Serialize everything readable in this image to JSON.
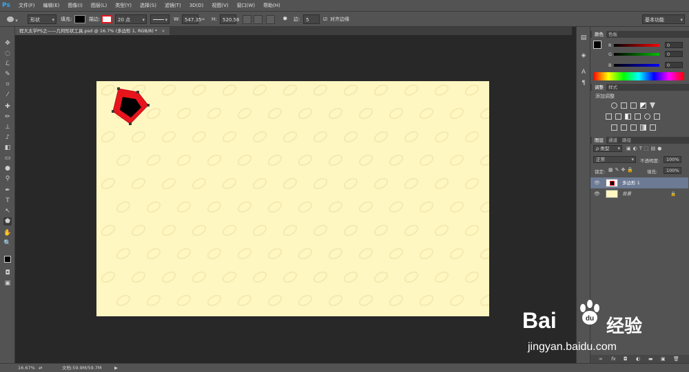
{
  "app": {
    "logo": "Ps",
    "menus": [
      "文件(F)",
      "编辑(E)",
      "图像(I)",
      "图层(L)",
      "类型(Y)",
      "选择(S)",
      "滤镜(T)",
      "3D(D)",
      "视图(V)",
      "窗口(W)",
      "帮助(H)"
    ]
  },
  "options": {
    "mode": "形状",
    "fill_label": "填充:",
    "stroke_label": "描边:",
    "stroke_width": "20 点",
    "w_label": "W:",
    "w_value": "547.35",
    "h_label": "H:",
    "h_value": "520.56",
    "sides_label": "边:",
    "sides_value": "5",
    "align_label": "对齐边缘",
    "workspace": "基本功能"
  },
  "document": {
    "tab_label": "程大太学PS之——几何形状工具.psd @ 16.7% (多边形 1, RGB/8) *",
    "tab_close": "×"
  },
  "status": {
    "zoom": "16.67%",
    "doc_info": "文档:59.9M/59.7M",
    "arrow": "▶"
  },
  "color_panel": {
    "tabs": [
      "颜色",
      "色板"
    ],
    "rows": [
      {
        "label": "R",
        "value": "0"
      },
      {
        "label": "G",
        "value": "0"
      },
      {
        "label": "B",
        "value": "0"
      }
    ]
  },
  "adjust_panel": {
    "tabs": [
      "调整",
      "样式"
    ],
    "heading": "添加调整"
  },
  "layers_panel": {
    "tabs": [
      "图层",
      "通道",
      "路径"
    ],
    "filter_kind": "类型",
    "blend_mode": "正常",
    "opacity_label": "不透明度:",
    "opacity_value": "100%",
    "lock_label": "锁定:",
    "fill_label": "填充:",
    "fill_value": "100%",
    "layers": [
      {
        "name": "多边形 1",
        "selected": true
      },
      {
        "name": "背景",
        "selected": false
      }
    ],
    "footer_icons": [
      "link-icon",
      "fx-icon",
      "mask-icon",
      "adjustment-icon",
      "folder-icon",
      "new-layer-icon",
      "trash-icon"
    ],
    "footer_glyphs": [
      "∞",
      "fx",
      "◘",
      "◐",
      "▬",
      "▣",
      "🗑"
    ]
  },
  "watermark": {
    "brand": "Bai",
    "brand_suffix": "经验",
    "url": "jingyan.baidu.com"
  },
  "colors": {
    "canvas": "#fff7c2",
    "polygon_fill": "#000000",
    "polygon_stroke": "#e8141c",
    "selected_layer": "#6c7a94"
  }
}
